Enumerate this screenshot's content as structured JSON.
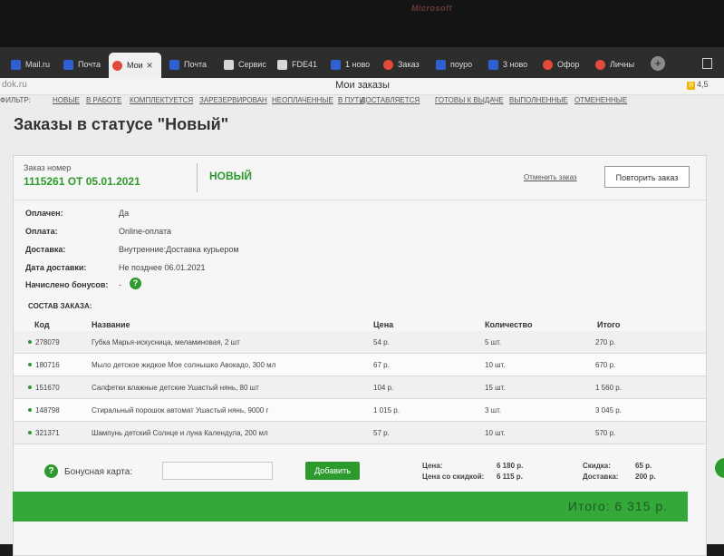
{
  "monitor": {
    "brand": "Microsoft"
  },
  "tabs": [
    {
      "label": "Mail.ru",
      "icon": "mailru-icon"
    },
    {
      "label": "Почта",
      "icon": "mail-icon"
    },
    {
      "label": "Мои",
      "icon": "site-icon",
      "active": true,
      "close": "×"
    },
    {
      "label": "Почта",
      "icon": "mail-icon"
    },
    {
      "label": "Сервис",
      "icon": "doc-icon"
    },
    {
      "label": "FDE41",
      "icon": "doc-icon"
    },
    {
      "label": "1 ново",
      "icon": "mail-icon"
    },
    {
      "label": "Заказ",
      "icon": "site-icon"
    },
    {
      "label": "поуро",
      "icon": "mail-icon"
    },
    {
      "label": "3 ново",
      "icon": "mail-icon"
    },
    {
      "label": "Офор",
      "icon": "site-icon"
    },
    {
      "label": "Личны",
      "icon": "site-icon"
    }
  ],
  "newtab": "+",
  "address": {
    "domain": "dok.ru",
    "page_title": "Мои заказы",
    "rating": "4,5",
    "rating_badge": "Я"
  },
  "filter": {
    "label": "ФИЛЬТР:",
    "items": [
      "НОВЫЕ",
      "В РАБОТЕ",
      "КОМПЛЕКТУЕТСЯ",
      "ЗАРЕЗЕРВИРОВАН",
      "НЕОПЛАЧЕННЫЕ",
      "В ПУТИ",
      "ДОСТАВЛЯЕТСЯ",
      "ГОТОВЫ К ВЫДАЧЕ",
      "ВЫПОЛНЕННЫЕ",
      "ОТМЕНЕННЫЕ"
    ]
  },
  "heading": "Заказы в статусе \"Новый\"",
  "order": {
    "number_label": "Заказ номер",
    "number": "1115261 ОТ 05.01.2021",
    "status": "НОВЫЙ",
    "cancel_label": "Отменить заказ",
    "repeat_label": "Повторить заказ"
  },
  "info": [
    {
      "label": "Оплачен:",
      "value": "Да"
    },
    {
      "label": "Оплата:",
      "value": "Online-оплата"
    },
    {
      "label": "Доставка:",
      "value": "Внутренние:Доставка курьером"
    },
    {
      "label": "Дата доставки:",
      "value": "Не позднее 06.01.2021"
    },
    {
      "label": "Начислено бонусов:",
      "value": "-"
    }
  ],
  "help_glyph": "?",
  "composition": {
    "title": "СОСТАВ ЗАКАЗА:",
    "headers": {
      "code": "Код",
      "name": "Название",
      "price": "Цена",
      "qty": "Количество",
      "total": "Итого"
    },
    "rows": [
      {
        "code": "278079",
        "name": "Губка Марья-искусница, меламиновая, 2 шт",
        "price": "54 р.",
        "qty": "5 шт.",
        "total": "270 р."
      },
      {
        "code": "180716",
        "name": "Мыло детское жидкое Мое солнышко Авокадо, 300 мл",
        "price": "67 р.",
        "qty": "10 шт.",
        "total": "670 р."
      },
      {
        "code": "151670",
        "name": "Салфетки влажные детские Ушастый нянь, 80 шт",
        "price": "104 р.",
        "qty": "15 шт.",
        "total": "1 560 р."
      },
      {
        "code": "148798",
        "name": "Стиральный порошок автомат Ушастый нянь, 9000 г",
        "price": "1 015 р.",
        "qty": "3 шт.",
        "total": "3 045 р."
      },
      {
        "code": "321371",
        "name": "Шампунь детский Солнце и луна Календула, 200 мл",
        "price": "57 р.",
        "qty": "10 шт.",
        "total": "570 р."
      }
    ]
  },
  "bonus": {
    "label": "Бонусная карта:",
    "value": "",
    "add_label": "Добавить"
  },
  "summary": {
    "price_label": "Цена:",
    "price": "6 180 р.",
    "discount_price_label": "Цена со скидкой:",
    "discount_price": "6 115 р.",
    "discount_label": "Скидка:",
    "discount": "65 р.",
    "delivery_label": "Доставка:",
    "delivery": "200 р."
  },
  "total": "Итого: 6 315 р."
}
